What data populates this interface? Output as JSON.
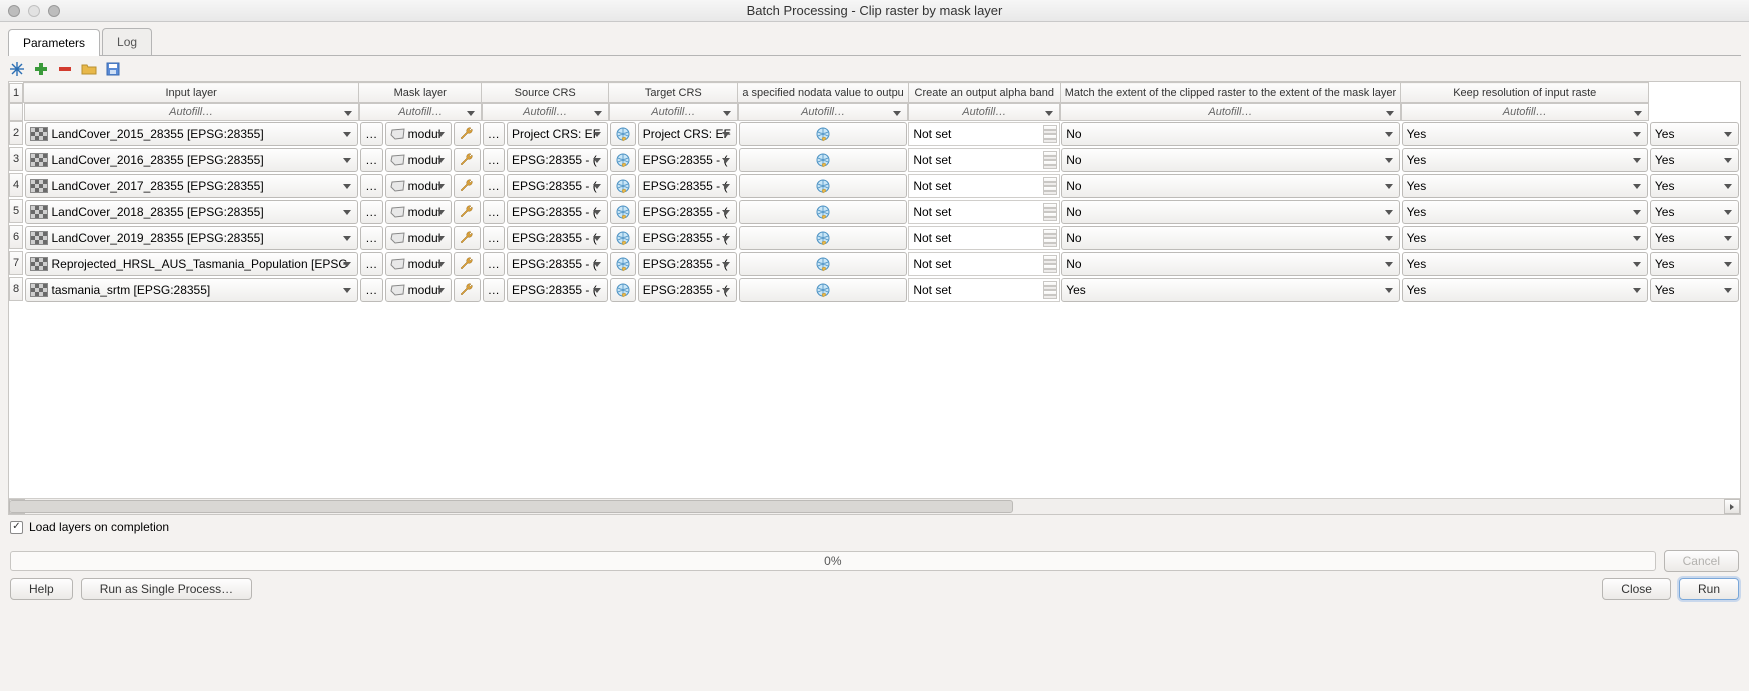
{
  "window": {
    "title": "Batch Processing - Clip raster by mask layer"
  },
  "tabs": {
    "parameters": "Parameters",
    "log": "Log"
  },
  "autofill_label": "Autofill…",
  "columns": {
    "input": "Input layer",
    "mask": "Mask layer",
    "source_crs": "Source CRS",
    "target_crs": "Target CRS",
    "nodata": "a specified nodata value to outpu",
    "alpha": "Create an output alpha band",
    "match_extent": "Match the extent of the clipped raster to the extent of the mask layer",
    "keep_res": "Keep resolution of input raste"
  },
  "mask_value": "modul",
  "dots": "…",
  "rows": [
    {
      "n": "2",
      "input": "LandCover_2015_28355 [EPSG:28355]",
      "src": "Project CRS: EF",
      "tgt": "Project CRS: EF",
      "nodata": "Not set",
      "alpha": "No",
      "match": "Yes",
      "keep": "Yes"
    },
    {
      "n": "3",
      "input": "LandCover_2016_28355 [EPSG:28355]",
      "src": "EPSG:28355 - (",
      "tgt": "EPSG:28355 - (",
      "nodata": "Not set",
      "alpha": "No",
      "match": "Yes",
      "keep": "Yes"
    },
    {
      "n": "4",
      "input": "LandCover_2017_28355 [EPSG:28355]",
      "src": "EPSG:28355 - (",
      "tgt": "EPSG:28355 - (",
      "nodata": "Not set",
      "alpha": "No",
      "match": "Yes",
      "keep": "Yes"
    },
    {
      "n": "5",
      "input": "LandCover_2018_28355 [EPSG:28355]",
      "src": "EPSG:28355 - (",
      "tgt": "EPSG:28355 - (",
      "nodata": "Not set",
      "alpha": "No",
      "match": "Yes",
      "keep": "Yes"
    },
    {
      "n": "6",
      "input": "LandCover_2019_28355 [EPSG:28355]",
      "src": "EPSG:28355 - (",
      "tgt": "EPSG:28355 - (",
      "nodata": "Not set",
      "alpha": "No",
      "match": "Yes",
      "keep": "Yes"
    },
    {
      "n": "7",
      "input": "Reprojected_HRSL_AUS_Tasmania_Population [EPSG",
      "src": "EPSG:28355 - (",
      "tgt": "EPSG:28355 - (",
      "nodata": "Not set",
      "alpha": "No",
      "match": "Yes",
      "keep": "Yes"
    },
    {
      "n": "8",
      "input": "tasmania_srtm [EPSG:28355]",
      "src": "EPSG:28355 - (",
      "tgt": "EPSG:28355 - (",
      "nodata": "Not set",
      "alpha": "Yes",
      "match": "Yes",
      "keep": "Yes"
    }
  ],
  "load_layers": "Load layers on completion",
  "progress": "0%",
  "buttons": {
    "cancel": "Cancel",
    "help": "Help",
    "single": "Run as Single Process…",
    "close": "Close",
    "run": "Run"
  }
}
